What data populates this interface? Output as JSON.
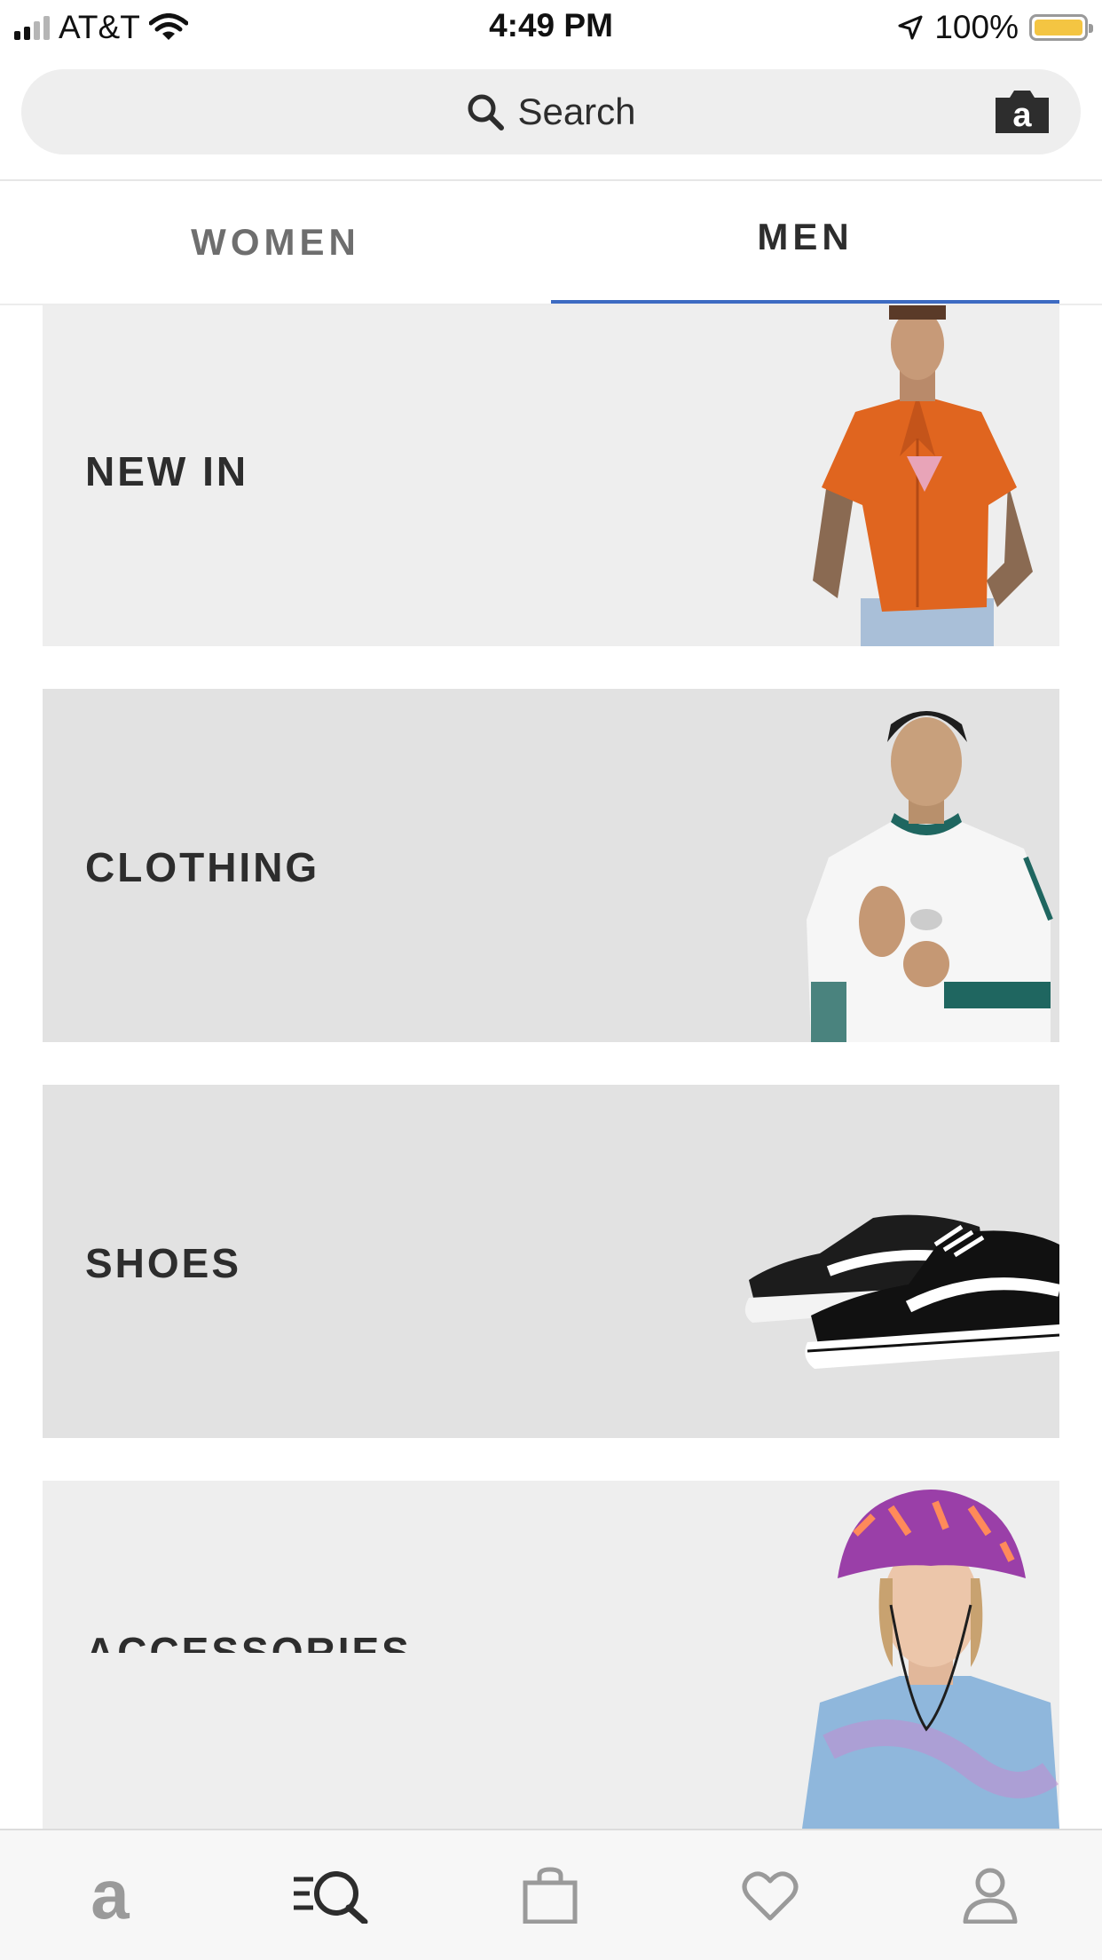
{
  "status_bar": {
    "carrier": "AT&T",
    "time": "4:49 PM",
    "battery": "100%",
    "icons": [
      "signal-icon",
      "wifi-icon",
      "location-arrow-icon",
      "battery-icon"
    ]
  },
  "search": {
    "placeholder": "Search",
    "icon": "search-icon",
    "camera_icon": "camera-search-icon"
  },
  "tabs": {
    "items": [
      {
        "label": "WOMEN",
        "selected": false
      },
      {
        "label": "MEN",
        "selected": true
      }
    ],
    "accent": "#3d6bc2"
  },
  "categories": [
    {
      "label": "NEW IN",
      "image": "model-orange-shirt",
      "background": "#eeeeee"
    },
    {
      "label": "CLOTHING",
      "image": "model-white-track-top",
      "background": "#e2e2e2"
    },
    {
      "label": "SHOES",
      "image": "black-white-sneakers",
      "background": "#e2e2e2"
    },
    {
      "label": "ACCESSORIES",
      "image": "model-bucket-hat",
      "background": "#eeeeee"
    }
  ],
  "bottom_nav": {
    "items": [
      {
        "icon": "home-logo-icon",
        "active": false
      },
      {
        "icon": "search-browse-icon",
        "active": true
      },
      {
        "icon": "bag-icon",
        "active": false
      },
      {
        "icon": "heart-icon",
        "active": false
      },
      {
        "icon": "account-icon",
        "active": false
      }
    ]
  }
}
